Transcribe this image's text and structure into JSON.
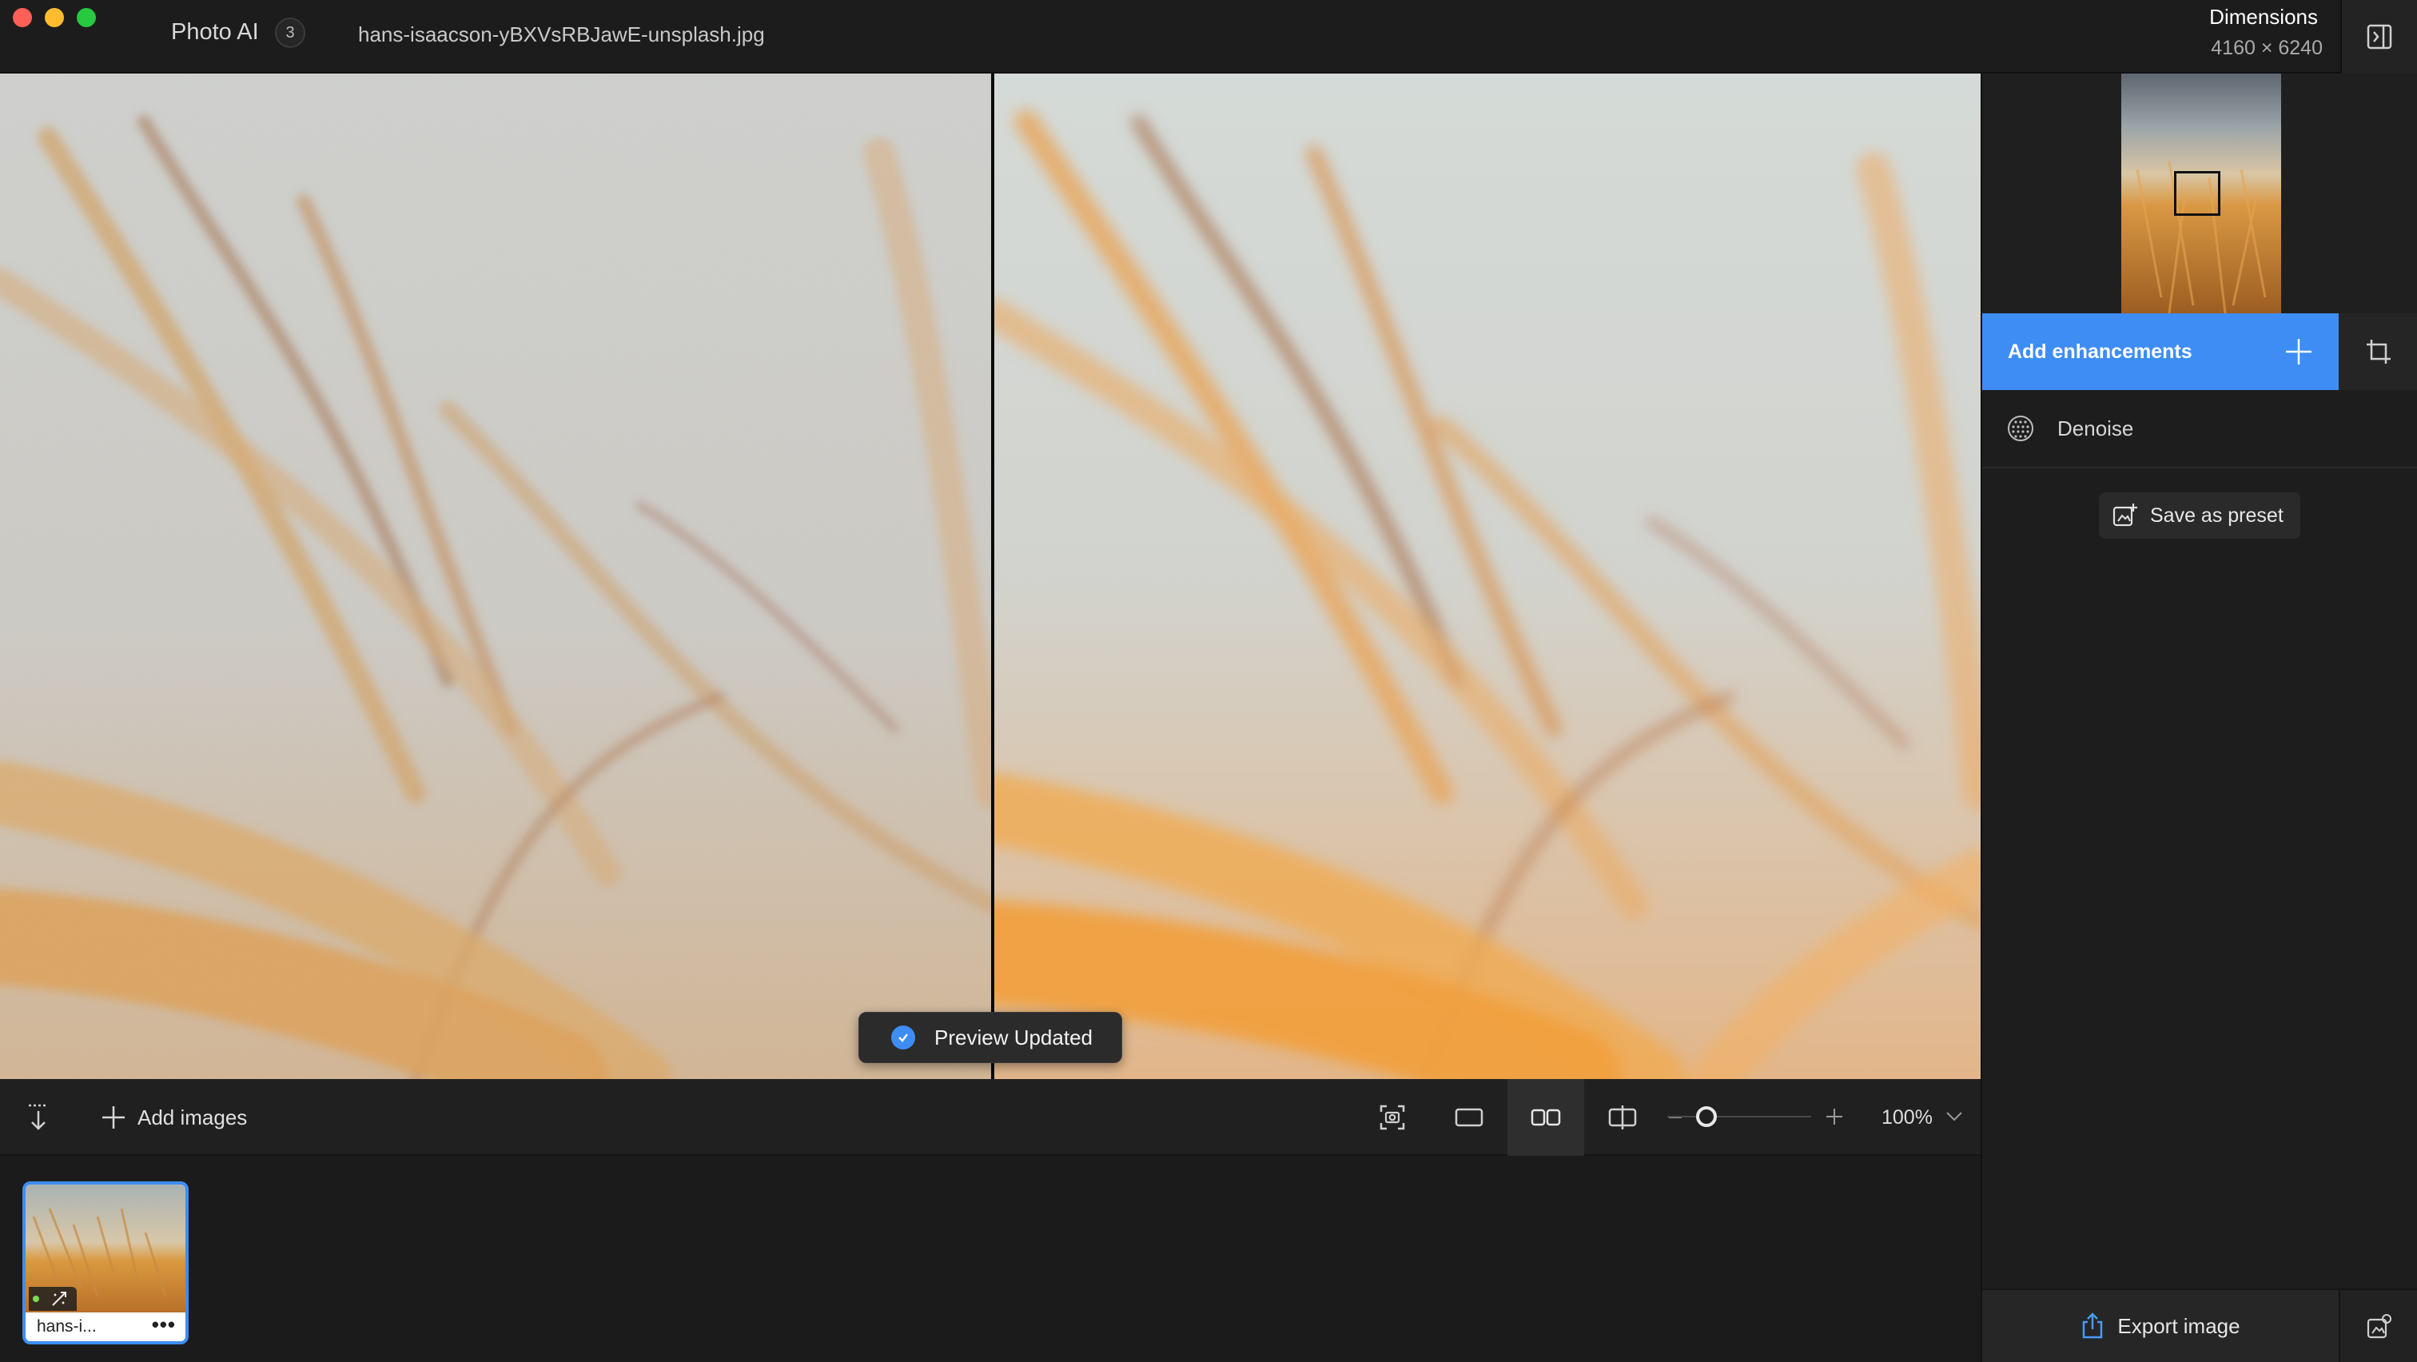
{
  "titlebar": {
    "app_name": "Photo AI",
    "image_count": "3",
    "filename": "hans-isaacson-yBXVsRBJawE-unsplash.jpg",
    "dimensions_label": "Dimensions",
    "dimensions_value": "4160 × 6240"
  },
  "viewer": {
    "toast": "Preview Updated",
    "accent": "#3d8df5"
  },
  "toolbar": {
    "add_images": "Add images",
    "zoom": "100%",
    "zoom_level_fraction": 0.2
  },
  "filmstrip": {
    "items": [
      {
        "name": "hans-i..."
      }
    ]
  },
  "right_panel": {
    "add_enhancements": "Add enhancements",
    "enhancements": [
      {
        "label": "Denoise"
      }
    ],
    "save_preset": "Save as preset",
    "export": "Export image"
  }
}
